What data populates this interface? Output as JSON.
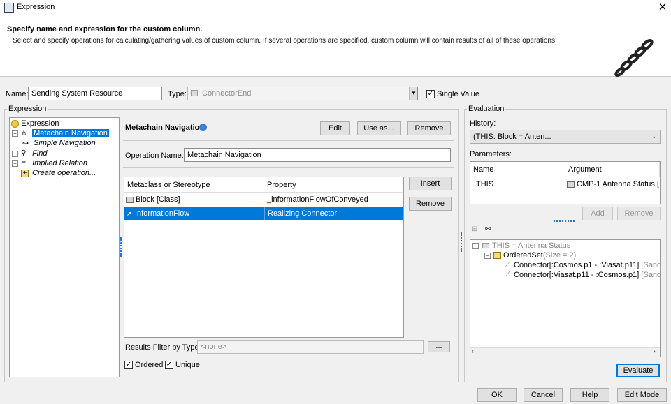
{
  "window": {
    "title": "Expression"
  },
  "header": {
    "title": "Specify name and expression for the custom column.",
    "description": "Select and specify operations for calculating/gathering values of custom column. If several operations are specified, custom column will contain results of all of these operations."
  },
  "form": {
    "name_label": "Name:",
    "name_value": "Sending System Resource",
    "type_label": "Type:",
    "type_value": "ConnectorEnd",
    "single_value_label": "Single Value"
  },
  "expression": {
    "group_label": "Expression",
    "tree": [
      "Expression",
      "Metachain Navigation",
      "Simple Navigation",
      "Find",
      "Implied Relation",
      "Create operation..."
    ],
    "panel_title": "Metachain Navigation",
    "edit_label": "Edit",
    "use_as_label": "Use as...",
    "remove_label": "Remove",
    "operation_name_label": "Operation Name:",
    "operation_name_value": "Metachain Navigation",
    "table": {
      "headers": [
        "Metaclass or Stereotype",
        "Property"
      ],
      "rows": [
        [
          "Block [Class]",
          "_informationFlowOfConveyed"
        ],
        [
          "InformationFlow",
          "Realizing Connector"
        ]
      ]
    },
    "insert_label": "Insert",
    "remove2_label": "Remove",
    "results_filter_label": "Results Filter by Type:",
    "results_filter_value": "<none>",
    "ellipsis_label": "...",
    "ordered_label": "Ordered",
    "unique_label": "Unique"
  },
  "evaluation": {
    "group_label": "Evaluation",
    "history_label": "History:",
    "history_value": "(THIS: Block = Anten...",
    "parameters_label": "Parameters:",
    "param_headers": [
      "Name",
      "Argument"
    ],
    "params": [
      [
        "THIS",
        "CMP-1 Antenna Status [..."
      ]
    ],
    "add_label": "Add",
    "remove_label": "Remove",
    "result_tree": [
      "THIS = Antenna Status",
      "OrderedSet",
      "(Size = 2)",
      "Connector[:Cosmos.p1 - :Viasat.p11]",
      "[Sandbox",
      "Connector[:Viasat.p11 - :Cosmos.p1]",
      "[Sandbox"
    ],
    "evaluate_label": "Evaluate"
  },
  "footer": {
    "ok": "OK",
    "cancel": "Cancel",
    "help": "Help",
    "edit_mode": "Edit Mode"
  }
}
